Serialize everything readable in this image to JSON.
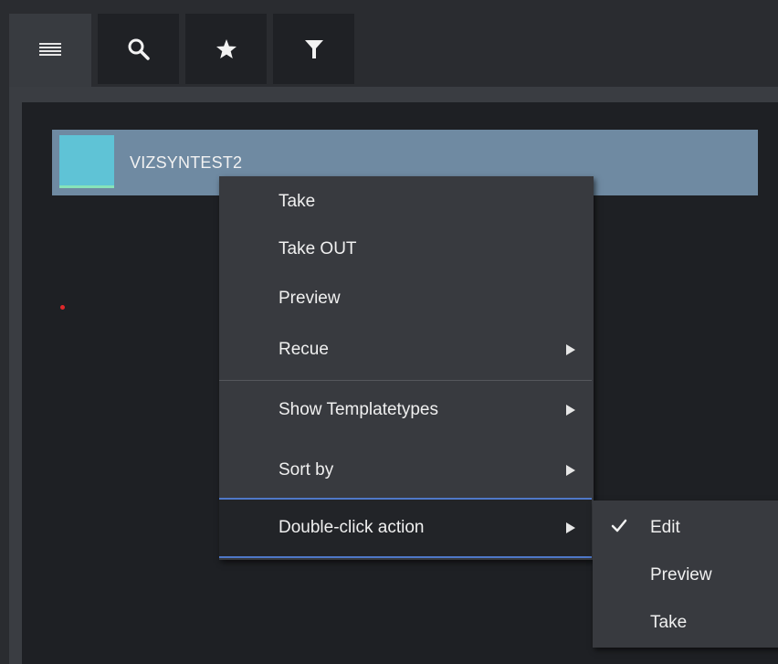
{
  "toolbar": {
    "tabs": [
      {
        "name": "menu-icon",
        "active": true
      },
      {
        "name": "search-icon",
        "active": false
      },
      {
        "name": "star-icon",
        "active": false
      },
      {
        "name": "filter-icon",
        "active": false
      }
    ]
  },
  "list": {
    "items": [
      {
        "label": "VIZSYNTEST2",
        "thumb_color": "#5fc3d6",
        "selected": true
      }
    ]
  },
  "context_menu": {
    "items": [
      {
        "label": "Take"
      },
      {
        "label": "Take OUT"
      },
      {
        "label": "Preview"
      },
      {
        "label": "Recue",
        "has_submenu": true
      },
      {
        "label": "Show Templatetypes",
        "has_submenu": true
      },
      {
        "label": "Sort by",
        "has_submenu": true
      },
      {
        "label": "Double-click action",
        "has_submenu": true,
        "highlighted": true
      }
    ],
    "submenu": {
      "items": [
        {
          "label": "Edit",
          "checked": true
        },
        {
          "label": "Preview",
          "checked": false
        },
        {
          "label": "Take",
          "checked": false
        }
      ]
    }
  },
  "colors": {
    "selection": "#6f8aa2",
    "highlight_border": "#4f78c8",
    "status_dot": "#e0282a"
  }
}
